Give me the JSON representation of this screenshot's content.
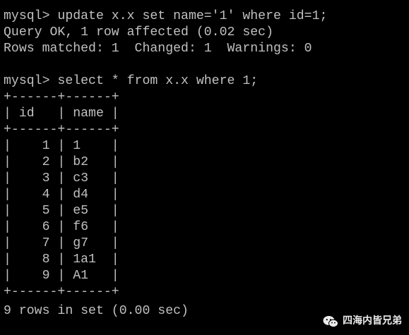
{
  "terminal": {
    "lines": [
      "mysql> update x.x set name='1' where id=1;",
      "Query OK, 1 row affected (0.02 sec)",
      "Rows matched: 1  Changed: 1  Warnings: 0",
      "",
      "mysql> select * from x.x where 1;",
      "+------+------+",
      "| id   | name |",
      "+------+------+",
      "|    1 | 1    |",
      "|    2 | b2   |",
      "|    3 | c3   |",
      "|    4 | d4   |",
      "|    5 | e5   |",
      "|    6 | f6   |",
      "|    7 | g7   |",
      "|    8 | 1a1  |",
      "|    9 | A1   |",
      "+------+------+",
      "9 rows in set (0.00 sec)"
    ]
  },
  "watermark": {
    "text": "四海内皆兄弟",
    "icon": "wechat-icon"
  },
  "colors": {
    "background": "#000000",
    "text": "#c0c0c0"
  }
}
